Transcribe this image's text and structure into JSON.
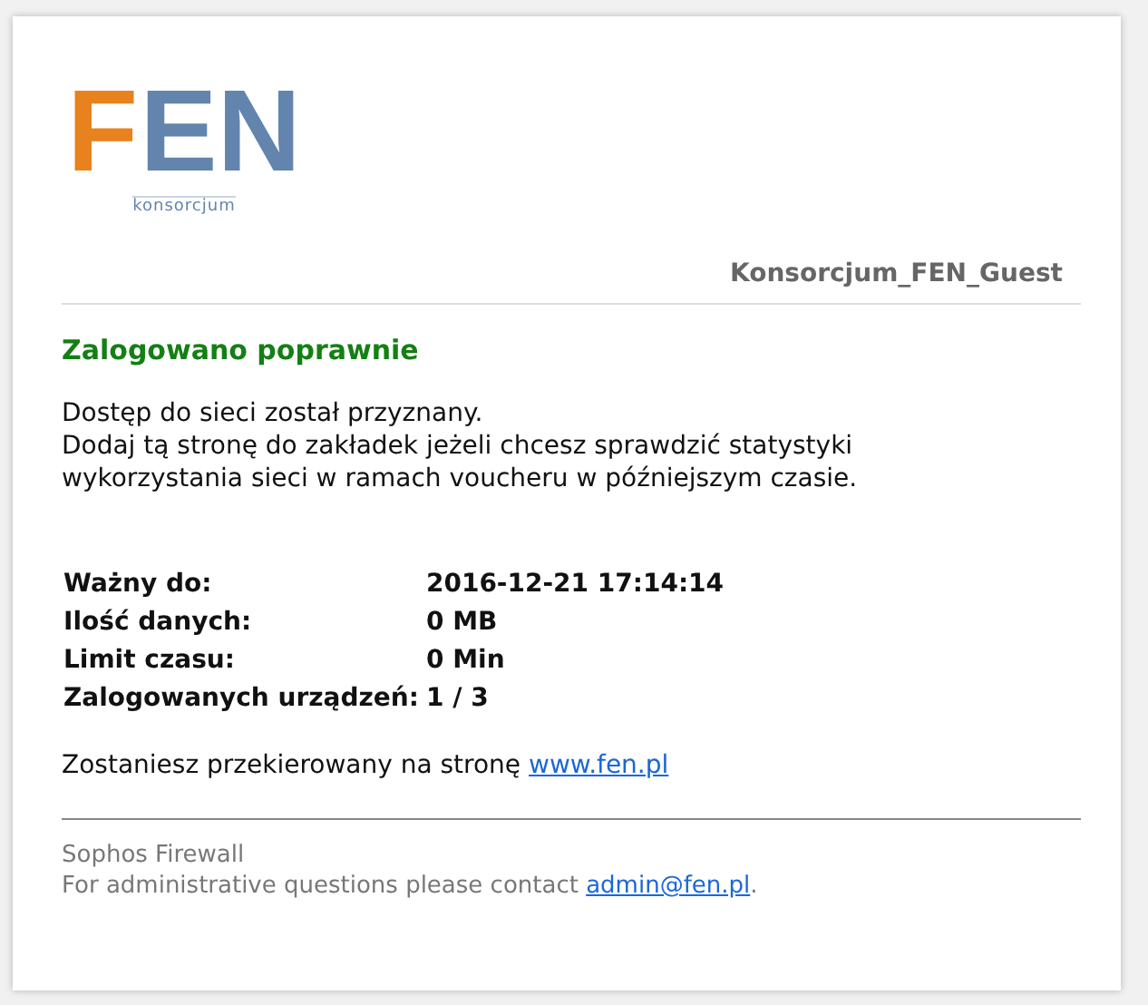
{
  "logo": {
    "letter_1": "F",
    "letter_2": "EN",
    "tagline": "konsorcjum"
  },
  "network_name": "Konsorcjum_FEN_Guest",
  "heading": "Zalogowano poprawnie",
  "message_lines": [
    "Dostęp do sieci został przyznany.",
    "Dodaj tą stronę do zakładek jeżeli chcesz sprawdzić statystyki wykorzystania sieci w ramach voucheru w późniejszym czasie."
  ],
  "details": [
    {
      "label": "Ważny do:",
      "value": "2016-12-21 17:14:14"
    },
    {
      "label": "Ilość danych:",
      "value": "0 MB"
    },
    {
      "label": "Limit czasu:",
      "value": "0 Min"
    },
    {
      "label": "Zalogowanych urządzeń:",
      "value": "1 / 3"
    }
  ],
  "redirect": {
    "text": "Zostaniesz przekierowany na stronę",
    "link": "www.fen.pl"
  },
  "footer": {
    "product": "Sophos Firewall",
    "contact_text": "For administrative questions please contact",
    "email": "admin@fen.pl",
    "trailing": "."
  }
}
